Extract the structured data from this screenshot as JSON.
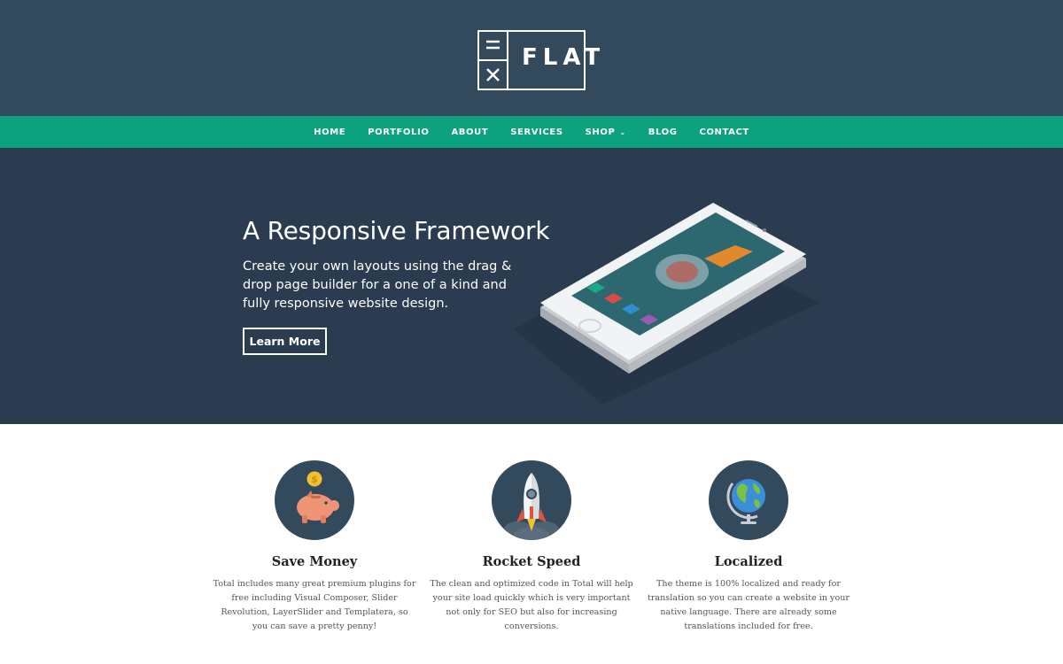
{
  "header": {
    "logo_text": "FLAT"
  },
  "nav": {
    "items": [
      {
        "label": "HOME"
      },
      {
        "label": "PORTFOLIO"
      },
      {
        "label": "ABOUT"
      },
      {
        "label": "SERVICES"
      },
      {
        "label": "SHOP",
        "has_dropdown": true
      },
      {
        "label": "BLOG"
      },
      {
        "label": "CONTACT"
      }
    ]
  },
  "hero": {
    "title": "A Responsive Framework",
    "text": "Create your own layouts using the drag & drop page builder for a one of a kind and fully responsive website design.",
    "button_label": "Learn More"
  },
  "features": [
    {
      "icon": "piggy-bank-icon",
      "title": "Save Money",
      "description": "Total includes many great premium plugins for free including Visual Composer, Slider Revolution, LayerSlider and Templatera, so you can save a pretty penny!"
    },
    {
      "icon": "rocket-icon",
      "title": "Rocket Speed",
      "description": "The clean and optimized code in Total will help your site load quickly which is very important not only for SEO but also for increasing conversions."
    },
    {
      "icon": "globe-icon",
      "title": "Localized",
      "description": "The theme is 100% localized and ready for translation so you can create a website in your native language. There are already some translations included for free."
    }
  ],
  "colors": {
    "header_bg": "#33495c",
    "nav_bg": "#0ca17f",
    "hero_bg": "#2c3c50",
    "icon_circle": "#33495c"
  }
}
